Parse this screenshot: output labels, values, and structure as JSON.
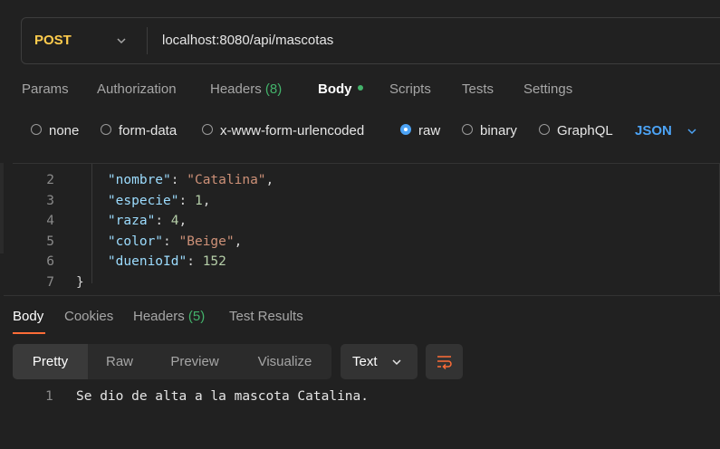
{
  "request": {
    "method": "POST",
    "url": "localhost:8080/api/mascotas"
  },
  "request_tabs": {
    "params": "Params",
    "authorization": "Authorization",
    "headers": "Headers",
    "headers_count": "(8)",
    "body": "Body",
    "scripts": "Scripts",
    "tests": "Tests",
    "settings": "Settings"
  },
  "body_types": {
    "none": "none",
    "form_data": "form-data",
    "urlencoded": "x-www-form-urlencoded",
    "raw": "raw",
    "binary": "binary",
    "graphql": "GraphQL",
    "selected": "raw",
    "language": "JSON"
  },
  "editor": {
    "lines": [
      {
        "num": "2",
        "key": "\"nombre\"",
        "value": "\"Catalina\"",
        "value_type": "string",
        "trail": ","
      },
      {
        "num": "3",
        "key": "\"especie\"",
        "value": "1",
        "value_type": "number",
        "trail": ","
      },
      {
        "num": "4",
        "key": "\"raza\"",
        "value": "4",
        "value_type": "number",
        "trail": ","
      },
      {
        "num": "5",
        "key": "\"color\"",
        "value": "\"Beige\"",
        "value_type": "string",
        "trail": ","
      },
      {
        "num": "6",
        "key": "\"duenioId\"",
        "value": "152",
        "value_type": "number",
        "trail": ""
      }
    ],
    "closing": {
      "num": "7",
      "text": "}"
    }
  },
  "response_tabs": {
    "body": "Body",
    "cookies": "Cookies",
    "headers": "Headers",
    "headers_count": "(5)",
    "test_results": "Test Results"
  },
  "response_view": {
    "pretty": "Pretty",
    "raw": "Raw",
    "preview": "Preview",
    "visualize": "Visualize",
    "format": "Text"
  },
  "response_body": {
    "lines": [
      {
        "num": "1",
        "text": "Se dio de alta a la mascota Catalina."
      }
    ]
  },
  "colors": {
    "method": "#ffcc4d",
    "accent_blue": "#4ca3f5",
    "accent_green": "#43b36b",
    "accent_orange": "#ff6c37"
  },
  "icons": [
    "chevron-down-icon",
    "wrap-lines-icon",
    "status-dot-icon"
  ]
}
